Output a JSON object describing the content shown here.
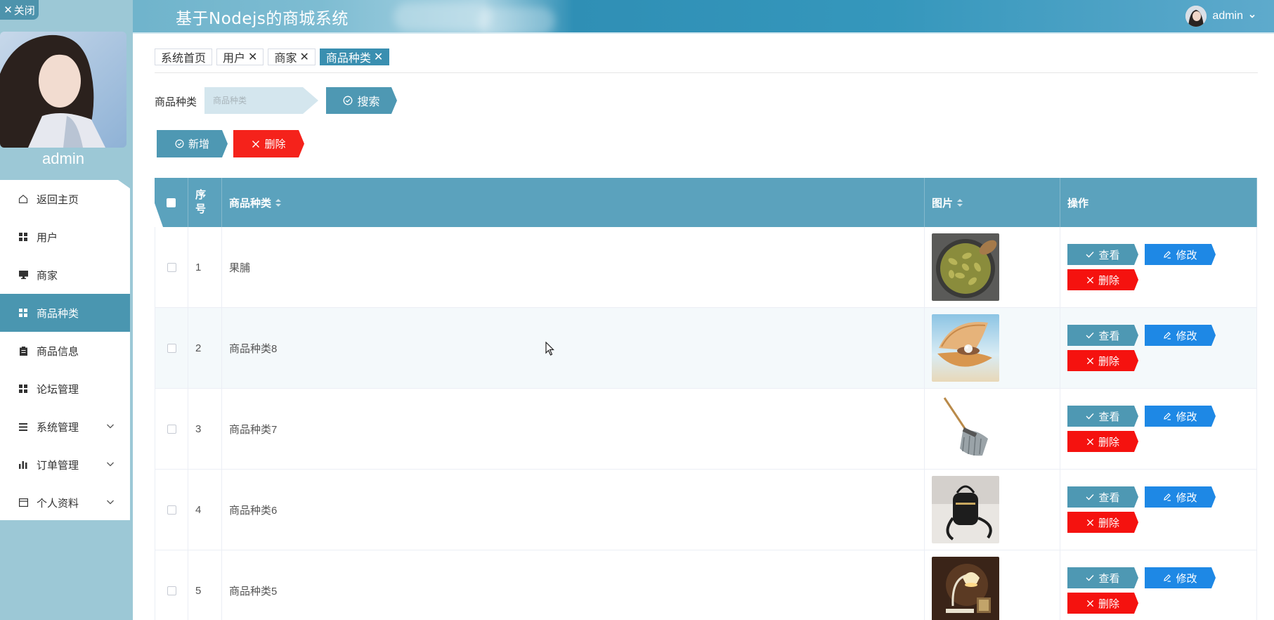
{
  "app": {
    "title": "基于Nodejs的商城系统",
    "close_label": "关闭"
  },
  "header": {
    "username": "admin"
  },
  "sidebar": {
    "profile_name": "admin",
    "items": [
      {
        "label": "返回主页",
        "icon": "home-icon"
      },
      {
        "label": "用户",
        "icon": "grid-icon"
      },
      {
        "label": "商家",
        "icon": "monitor-icon"
      },
      {
        "label": "商品种类",
        "icon": "grid-icon",
        "active": true
      },
      {
        "label": "商品信息",
        "icon": "clipboard-icon"
      },
      {
        "label": "论坛管理",
        "icon": "grid-icon"
      },
      {
        "label": "系统管理",
        "icon": "list-icon",
        "expandable": true
      },
      {
        "label": "订单管理",
        "icon": "bar-chart-icon",
        "expandable": true
      },
      {
        "label": "个人资料",
        "icon": "card-icon",
        "expandable": true
      }
    ]
  },
  "tabs": [
    {
      "label": "系统首页",
      "closable": false
    },
    {
      "label": "用户",
      "closable": true
    },
    {
      "label": "商家",
      "closable": true
    },
    {
      "label": "商品种类",
      "closable": true,
      "active": true
    }
  ],
  "search": {
    "label": "商品种类",
    "placeholder": "商品种类",
    "button_label": "搜索"
  },
  "toolbar": {
    "add_label": "新增",
    "delete_label": "删除"
  },
  "table": {
    "headers": {
      "index": "序号",
      "name": "商品种类",
      "image": "图片",
      "actions": "操作"
    },
    "rows": [
      {
        "index": "1",
        "name": "果脯",
        "image": "dried-fruit-photo"
      },
      {
        "index": "2",
        "name": "商品种类8",
        "image": "pearl-shell-photo"
      },
      {
        "index": "3",
        "name": "商品种类7",
        "image": "mop-photo"
      },
      {
        "index": "4",
        "name": "商品种类6",
        "image": "black-bag-photo"
      },
      {
        "index": "5",
        "name": "商品种类5",
        "image": "lamp-photo"
      }
    ],
    "row_actions": {
      "view": "查看",
      "edit": "修改",
      "delete": "删除"
    }
  },
  "colors": {
    "primary": "#4e98b3",
    "header_bg": "#3597bc",
    "danger": "#f5221b",
    "edit": "#1e88e5",
    "sidebar_bg": "#9cc8d6"
  }
}
